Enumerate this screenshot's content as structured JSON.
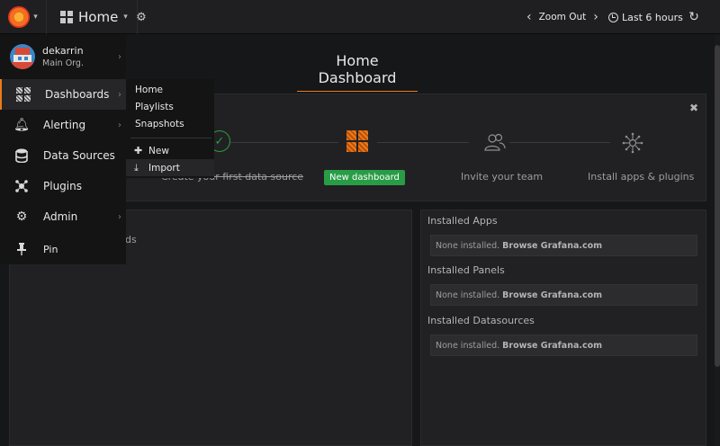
{
  "navbar": {
    "home_label": "Home",
    "zoom_out_label": "Zoom Out",
    "time_range_label": "Last 6 hours"
  },
  "dashboard": {
    "title": "Home Dashboard"
  },
  "getting_started": {
    "steps": [
      {
        "label": "Create your first data source",
        "done": true
      },
      {
        "label": "New dashboard",
        "is_button": true
      },
      {
        "label": "Invite your team"
      },
      {
        "label": "Install apps & plugins"
      }
    ]
  },
  "left_panel": {
    "fragment_text": "ds"
  },
  "right_panel": {
    "sections": [
      {
        "heading": "Installed Apps",
        "none_text": "None installed.",
        "link_text": "Browse Grafana.com"
      },
      {
        "heading": "Installed Panels",
        "none_text": "None installed.",
        "link_text": "Browse Grafana.com"
      },
      {
        "heading": "Installed Datasources",
        "none_text": "None installed.",
        "link_text": "Browse Grafana.com"
      }
    ]
  },
  "sidemenu": {
    "user": {
      "name": "dekarrin",
      "org": "Main Org."
    },
    "items": [
      {
        "label": "Dashboards",
        "icon": "dashboards-icon",
        "active": true
      },
      {
        "label": "Alerting",
        "icon": "bell-icon"
      },
      {
        "label": "Data Sources",
        "icon": "database-icon"
      },
      {
        "label": "Plugins",
        "icon": "plugins-icon"
      },
      {
        "label": "Admin",
        "icon": "cogs-icon"
      },
      {
        "label": "Pin",
        "icon": "pin-icon"
      }
    ]
  },
  "submenu": {
    "links": [
      "Home",
      "Playlists",
      "Snapshots"
    ],
    "new_label": "New",
    "import_label": "Import"
  },
  "colors": {
    "accent": "#eb7b18",
    "success": "#299c46",
    "background": "#161719"
  }
}
